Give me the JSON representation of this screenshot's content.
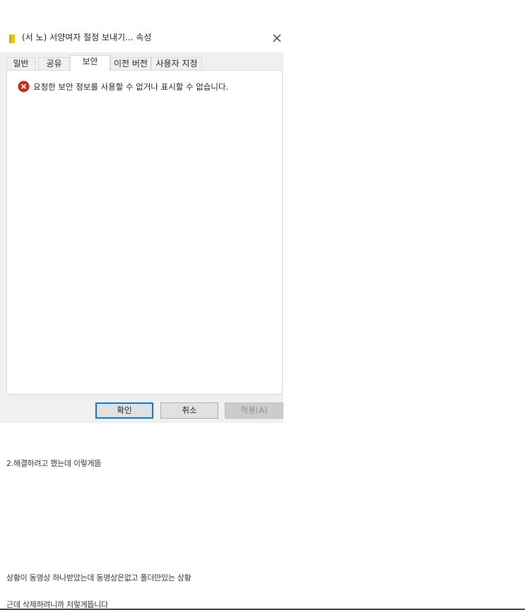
{
  "window": {
    "title": "(서 노) 서양여자 절정 보내기... 속성",
    "title_icon": "folder-icon",
    "close_icon": "close-icon"
  },
  "tabs": [
    {
      "label": "일반",
      "active": false
    },
    {
      "label": "공유",
      "active": false
    },
    {
      "label": "보안",
      "active": true
    },
    {
      "label": "이전 버전",
      "active": false
    },
    {
      "label": "사용자 지정",
      "active": false
    }
  ],
  "security": {
    "error_icon": "error-icon",
    "error_color": "#c42b1c",
    "message": "요청한 보안 정보를 사용할 수 없거나 표시할 수 없습니다."
  },
  "buttons": {
    "ok": "확인",
    "cancel": "취소",
    "apply": "적용(A)"
  },
  "post": {
    "line1": "2.해결하려고 했는데 이렇게뜸",
    "line2": "상황이 동영상 하나받았는데 동영상은없고 폴더만있는 상황",
    "line3": "근데 삭제하려니까 저렇게뜹니다"
  },
  "colors": {
    "accent": "#0078d7",
    "dialog_bg": "#f0f0f0",
    "folder": "#f5c400"
  }
}
